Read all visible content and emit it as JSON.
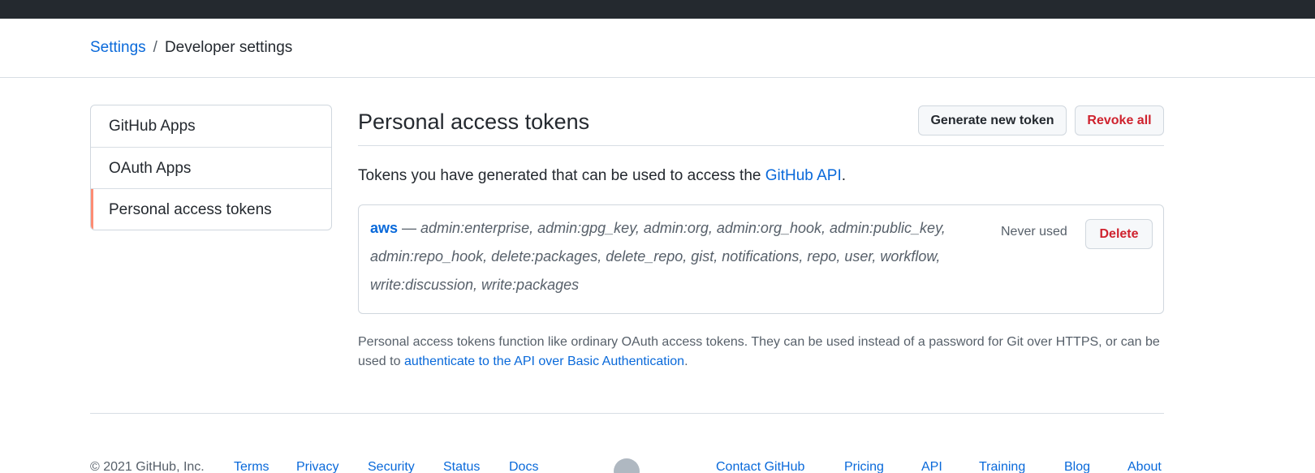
{
  "breadcrumb": {
    "root": "Settings",
    "separator": "/",
    "current": "Developer settings"
  },
  "sidebar": {
    "items": [
      {
        "label": "GitHub Apps"
      },
      {
        "label": "OAuth Apps"
      },
      {
        "label": "Personal access tokens",
        "selected": true
      }
    ]
  },
  "main": {
    "title": "Personal access tokens",
    "generate_button": "Generate new token",
    "revoke_all_button": "Revoke all",
    "intro_text": "Tokens you have generated that can be used to access the",
    "intro_link": "GitHub API",
    "intro_end": "."
  },
  "tokens": [
    {
      "name": "aws",
      "dash": " — ",
      "scopes": "admin:enterprise, admin:gpg_key, admin:org, admin:org_hook, admin:public_key, admin:repo_hook, delete:packages, delete_repo, gist, notifications, repo, user, workflow, write:discussion, write:packages",
      "status": "Never used",
      "delete_label": "Delete"
    }
  ],
  "note": {
    "text": "Personal access tokens function like ordinary OAuth access tokens. They can be used instead of a password for Git over HTTPS, or can be used to",
    "link": "authenticate to the API over Basic Authentication",
    "end": "."
  },
  "footer": {
    "copyright": "© 2021 GitHub, Inc.",
    "left_links": [
      "Terms",
      "Privacy",
      "Security",
      "Status",
      "Docs"
    ],
    "right_links": [
      "Contact GitHub",
      "Pricing",
      "API",
      "Training",
      "Blog",
      "About"
    ],
    "logo_icon": "github-mark-icon"
  },
  "colors": {
    "topbar": "#24292f",
    "link": "#0969da",
    "danger": "#cf222e",
    "selected_accent": "#fd8c73",
    "muted_text": "#57606a",
    "border": "#d0d7de"
  }
}
